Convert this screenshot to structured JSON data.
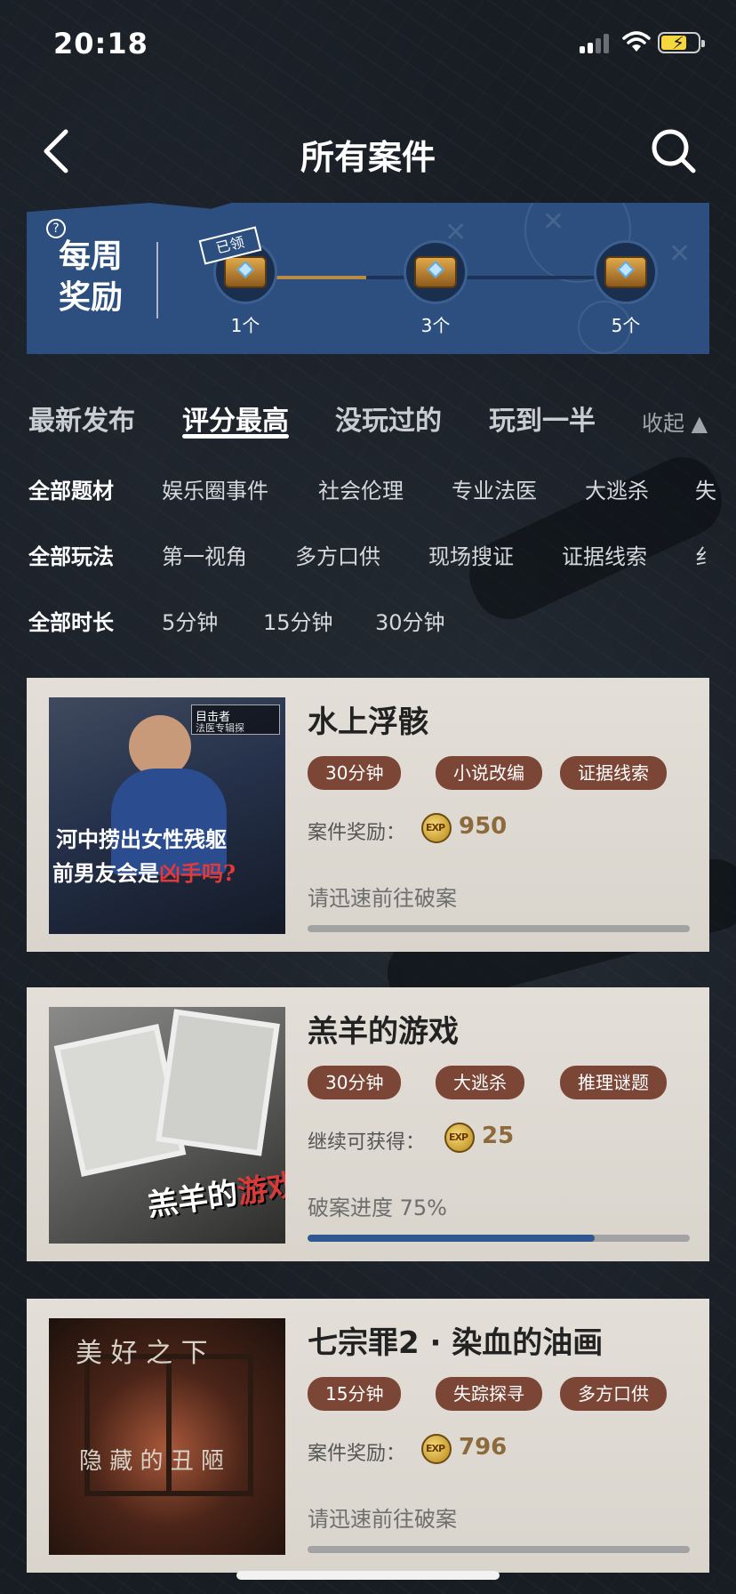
{
  "status_bar": {
    "time": "20:18"
  },
  "nav": {
    "title": "所有案件"
  },
  "weekly": {
    "help": "?",
    "title": "每周奖励",
    "claimed_tag": "已领",
    "milestones": [
      {
        "label": "1个"
      },
      {
        "label": "3个"
      },
      {
        "label": "5个"
      }
    ]
  },
  "tabs": {
    "items": [
      "最新发布",
      "评分最高",
      "没玩过的",
      "玩到一半"
    ],
    "active_index": 1,
    "collapse": "收起"
  },
  "filters": {
    "genre": [
      "全部题材",
      "娱乐圈事件",
      "社会伦理",
      "专业法医",
      "大逃杀",
      "失"
    ],
    "gameplay": [
      "全部玩法",
      "第一视角",
      "多方口供",
      "现场搜证",
      "证据线索",
      "纟"
    ],
    "duration": [
      "全部时长",
      "5分钟",
      "15分钟",
      "30分钟"
    ]
  },
  "cards": [
    {
      "title": "水上浮骸",
      "tags": [
        "30分钟",
        "小说改编",
        "证据线索"
      ],
      "reward_label": "案件奖励：",
      "reward_value": "950",
      "status": "请迅速前往破案",
      "progress": 0,
      "cover": {
        "badge_main": "目击者",
        "badge_sub": "法医专辑探",
        "line1": "河中捞出女性残躯",
        "line2_a": "前男友会是",
        "line2_b": "凶手吗?"
      }
    },
    {
      "title": "羔羊的游戏",
      "tags": [
        "30分钟",
        "大逃杀",
        "推理谜题"
      ],
      "reward_label": "继续可获得：",
      "reward_value": "25",
      "status": "破案进度 75%",
      "progress": 0.75,
      "cover": {
        "logo_a": "羔羊的",
        "logo_b": "游戏"
      }
    },
    {
      "title": "七宗罪2 · 染血的油画",
      "tags": [
        "15分钟",
        "失踪探寻",
        "多方口供"
      ],
      "reward_label": "案件奖励：",
      "reward_value": "796",
      "status": "请迅速前往破案",
      "progress": 0,
      "cover": {
        "top_text": "美 好 之 下",
        "bottom_text": "隐 藏 的 丑 陋"
      }
    }
  ],
  "exp_icon_text": "EXP",
  "colors": {
    "banner": "#2c4f7f",
    "card": "#dedad3",
    "tag": "#7b4636",
    "reward": "#8c6a3b",
    "progress_fill": "#2f5790",
    "progress_track": "#a3a3a3",
    "battery": "#f5d63d"
  }
}
